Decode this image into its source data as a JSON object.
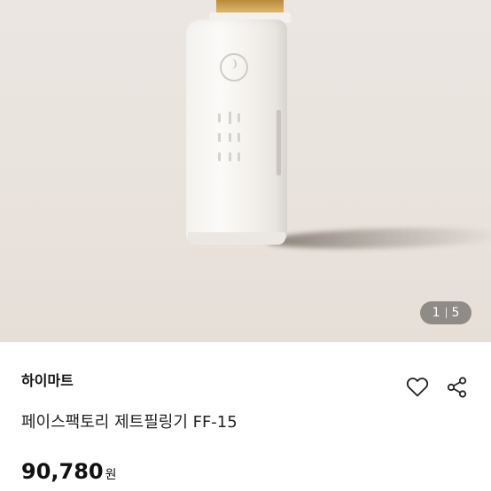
{
  "gallery": {
    "image_alt": "white ultrasonic skin scrubber device",
    "pager": {
      "current": "1",
      "total": "5"
    }
  },
  "product": {
    "store_name": "하이마트",
    "title": "페이스팩토리 제트필링기 FF-15",
    "price": "90,780",
    "currency": "원"
  },
  "actions": {
    "like_icon": "heart-outline-icon",
    "share_icon": "share-icon"
  }
}
